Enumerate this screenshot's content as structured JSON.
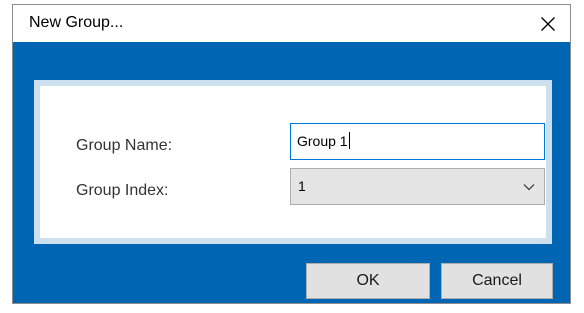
{
  "dialog": {
    "title": "New Group...",
    "close_icon": "close-icon"
  },
  "form": {
    "group_name_label": "Group Name:",
    "group_name_value": "Group 1",
    "group_index_label": "Group Index:",
    "group_index_value": "1",
    "dropdown_icon": "chevron-down-icon"
  },
  "buttons": {
    "ok_label": "OK",
    "cancel_label": "Cancel"
  },
  "colors": {
    "client_background": "#0066b3",
    "panel_border": "#cde0ef",
    "input_focus_border": "#0078d7",
    "button_background": "#e1e1e1"
  }
}
